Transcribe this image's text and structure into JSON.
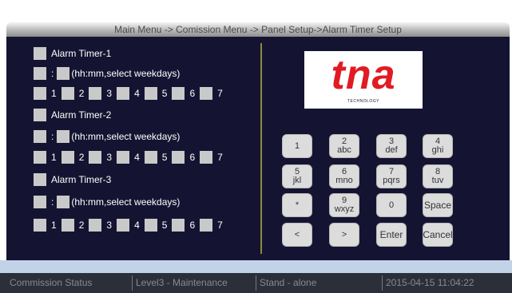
{
  "header": {
    "breadcrumb": "Main Menu -> Comission Menu -> Panel Setup->Alarm Timer Setup"
  },
  "timers": [
    {
      "label": "Alarm Timer-1",
      "time_sep": ":",
      "time_hint": "(hh:mm,select weekdays)",
      "days": [
        "1",
        "2",
        "3",
        "4",
        "5",
        "6",
        "7"
      ]
    },
    {
      "label": "Alarm Timer-2",
      "time_sep": ":",
      "time_hint": "(hh:mm,select weekdays)",
      "days": [
        "1",
        "2",
        "3",
        "4",
        "5",
        "6",
        "7"
      ]
    },
    {
      "label": "Alarm Timer-3",
      "time_sep": ":",
      "time_hint": "(hh:mm,select weekdays)",
      "days": [
        "1",
        "2",
        "3",
        "4",
        "5",
        "6",
        "7"
      ]
    }
  ],
  "logo": {
    "brand": "tna",
    "tagline": "TECHNOLOGY",
    "color": "#e11b23"
  },
  "keypad": [
    [
      {
        "main": "1",
        "sub": ""
      },
      {
        "main": "2",
        "sub": "abc"
      },
      {
        "main": "3",
        "sub": "def"
      },
      {
        "main": "4",
        "sub": "ghi"
      }
    ],
    [
      {
        "main": "5",
        "sub": "jkl"
      },
      {
        "main": "6",
        "sub": "mno"
      },
      {
        "main": "7",
        "sub": "pqrs"
      },
      {
        "main": "8",
        "sub": "tuv"
      }
    ],
    [
      {
        "main": "*",
        "sub": ""
      },
      {
        "main": "9",
        "sub": "wxyz"
      },
      {
        "main": "0",
        "sub": ""
      },
      {
        "main": "Space",
        "sub": ""
      }
    ],
    [
      {
        "main": "<",
        "sub": ""
      },
      {
        "main": ">",
        "sub": ""
      },
      {
        "main": "Enter",
        "sub": ""
      },
      {
        "main": "Cancel",
        "sub": ""
      }
    ]
  ],
  "status": {
    "commission": "Commission Status",
    "level": "Level3 - Maintenance",
    "mode": "Stand - alone",
    "datetime": "2015-04-15 11:04:22"
  },
  "colors": {
    "panel_background": "#141432",
    "checkbox": "#c9c9c9",
    "key_background": "#dcdcdc"
  }
}
